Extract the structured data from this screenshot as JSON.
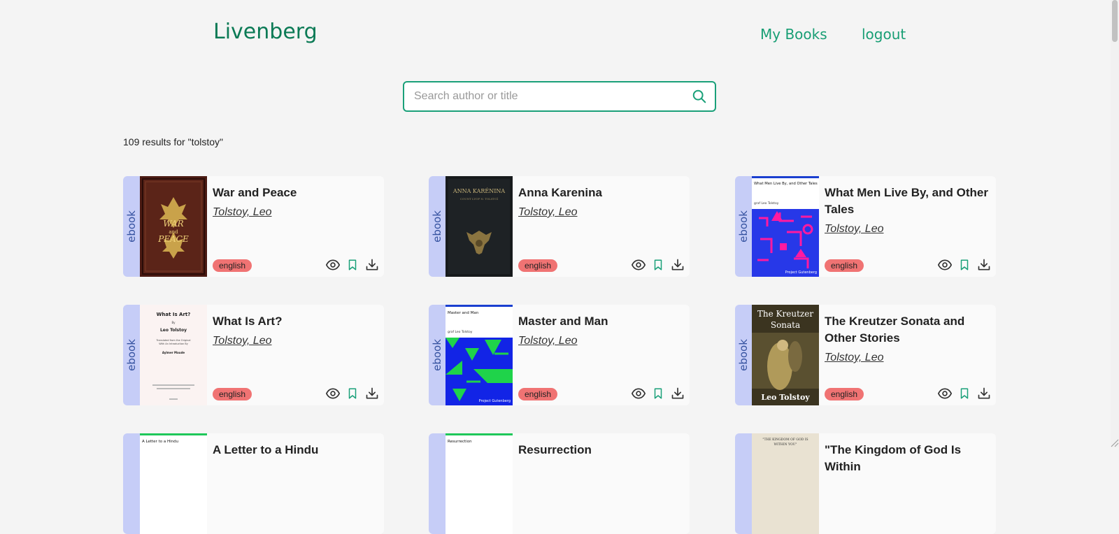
{
  "header": {
    "logo": "Livenberg",
    "nav": {
      "my_books": "My Books",
      "logout": "logout"
    }
  },
  "search": {
    "placeholder": "Search author or title",
    "value": "",
    "icon": "search-icon"
  },
  "results": {
    "summary": "109 results for \"tolstoy\""
  },
  "cards": [
    {
      "type": "ebook",
      "title": "War and Peace",
      "author": "Tolstoy, Leo",
      "language": "english",
      "cover_lines": [
        "WAR",
        "and",
        "PEACE"
      ]
    },
    {
      "type": "ebook",
      "title": "Anna Karenina",
      "author": "Tolstoy, Leo",
      "language": "english",
      "cover_lines": [
        "ANNA KARÉNINA",
        "COUNT LYOF N. TOLSTOÏ"
      ]
    },
    {
      "type": "ebook",
      "title": "What Men Live By, and Other Tales",
      "author": "Tolstoy, Leo",
      "language": "english",
      "cover_lines": [
        "What Men Live By, and Other Tales",
        "graf Leo Tolstoy",
        "Project Gutenberg"
      ]
    },
    {
      "type": "ebook",
      "title": "What Is Art?",
      "author": "Tolstoy, Leo",
      "language": "english",
      "cover_lines": [
        "What Is Art?",
        "By",
        "Leo Tolstoy",
        "Translated from the Original",
        "With An Introduction By",
        "Aylmer Maude"
      ]
    },
    {
      "type": "ebook",
      "title": "Master and Man",
      "author": "Tolstoy, Leo",
      "language": "english",
      "cover_lines": [
        "Master and Man",
        "graf Leo Tolstoy",
        "Project Gutenberg"
      ]
    },
    {
      "type": "ebook",
      "title": "The Kreutzer Sonata and Other Stories",
      "author": "Tolstoy, Leo",
      "language": "english",
      "cover_lines": [
        "The Kreutzer",
        "Sonata",
        "Leo Tolstoy"
      ]
    },
    {
      "type": "ebook",
      "title": "A Letter to a Hindu",
      "author": "",
      "language": "",
      "cover_lines": [
        "A Letter to a Hindu"
      ]
    },
    {
      "type": "ebook",
      "title": "Resurrection",
      "author": "",
      "language": "",
      "cover_lines": [
        "Resurrection"
      ]
    },
    {
      "type": "ebook",
      "title": "\"The Kingdom of God Is Within",
      "author": "",
      "language": "",
      "cover_lines": [
        "\"THE KINGDOM OF GOD IS",
        "WITHIN YOU\""
      ]
    }
  ],
  "icons": {
    "view": "eye-icon",
    "bookmark": "bookmark-icon",
    "download": "download-icon"
  },
  "colors": {
    "brand": "#0b7a55",
    "accent": "#1aa079",
    "badge": "#f07373",
    "type_strip": "#c6cdf7"
  }
}
